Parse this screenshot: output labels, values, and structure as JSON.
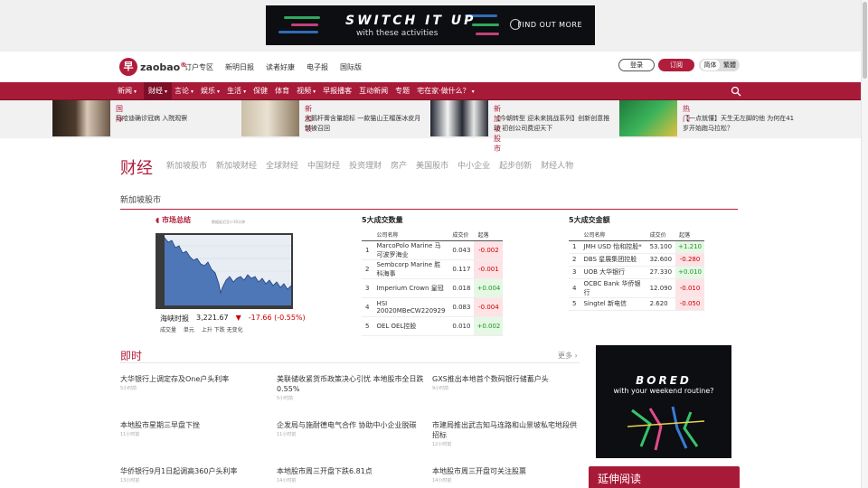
{
  "ad_top": {
    "headline": "SWITCH IT UP",
    "sub": "with these activities",
    "cta": "FIND OUT MORE"
  },
  "masthead": {
    "logo": "zaobao",
    "logo_mark": "早",
    "links": [
      "订户专区",
      "新明日报",
      "读者好康",
      "电子报",
      "国际版"
    ],
    "login": "登录",
    "subscribe": "订阅",
    "lang_simplified": "简体",
    "lang_traditional": "繁體"
  },
  "nav": {
    "items": [
      {
        "label": "新闻",
        "caret": true
      },
      {
        "label": "财经",
        "caret": true
      },
      {
        "label": "言论",
        "caret": true
      },
      {
        "label": "娱乐",
        "caret": true
      },
      {
        "label": "生活",
        "caret": true
      },
      {
        "label": "保健",
        "caret": false
      },
      {
        "label": "体育",
        "caret": false
      },
      {
        "label": "视频",
        "caret": true
      },
      {
        "label": "早报播客",
        "caret": false
      },
      {
        "label": "互动新闻",
        "caret": false
      },
      {
        "label": "专题",
        "caret": false
      },
      {
        "label": "宅在家·做什么？",
        "caret": true
      }
    ]
  },
  "ticker": [
    {
      "cat": "国际",
      "title": "马哈迪确诊冠病 入院观察"
    },
    {
      "cat": "新加坡",
      "title": "大鹅杆膏含量超标 一款猫山王榴莲冰皮月饼被召回"
    },
    {
      "cat": "新加坡股市",
      "title": "【今朝转型 迎未来挑战系列】创新创意推动 初创公司费迎天下"
    },
    {
      "cat": "热门",
      "title": "【一点就懂】天生无左脚的他 为何在41岁开始跑马拉松？"
    }
  ],
  "section": {
    "title": "财经",
    "subnav": [
      "新加坡股市",
      "新加坡财经",
      "全球财经",
      "中国财经",
      "投资理财",
      "房产",
      "美国股市",
      "中小企业",
      "起步创新",
      "财经人物"
    ],
    "subheading": "新加坡股市"
  },
  "market": {
    "header": "市场总结",
    "sub": "数据延迟至少30分钟",
    "index_name": "海峡时报",
    "index_value": "3,221.67",
    "index_change": "-17.66 (-0.55%)",
    "footer": "成交量　 单元　 上升  下跌  无变化"
  },
  "volume_table": {
    "title": "5大成交数量",
    "headers": [
      "公司名称",
      "成交价",
      "起落"
    ],
    "rows": [
      {
        "n": "1",
        "name": "MarcoPolo Marine 马可波罗海业",
        "price": "0.043",
        "chg": "-0.002",
        "dir": "neg"
      },
      {
        "n": "2",
        "name": "Sembcorp Marine 胜科海事",
        "price": "0.117",
        "chg": "-0.001",
        "dir": "neg"
      },
      {
        "n": "3",
        "name": "Imperium Crown 皇冠",
        "price": "0.018",
        "chg": "+0.004",
        "dir": "pos"
      },
      {
        "n": "4",
        "name": "HSI 20020MBeCW220929",
        "price": "0.083",
        "chg": "-0.004",
        "dir": "neg"
      },
      {
        "n": "5",
        "name": "OEL OEL控股",
        "price": "0.010",
        "chg": "+0.002",
        "dir": "pos"
      }
    ]
  },
  "value_table": {
    "title": "5大成交金额",
    "headers": [
      "公司名称",
      "成交价",
      "起落"
    ],
    "rows": [
      {
        "n": "1",
        "name": "JMH USD 怡和控股*",
        "price": "53.100",
        "chg": "+1.210",
        "dir": "pos"
      },
      {
        "n": "2",
        "name": "DBS 星展集团控股",
        "price": "32.600",
        "chg": "-0.280",
        "dir": "neg"
      },
      {
        "n": "3",
        "name": "UOB 大华银行",
        "price": "27.330",
        "chg": "+0.010",
        "dir": "pos"
      },
      {
        "n": "4",
        "name": "OCBC Bank 华侨银行",
        "price": "12.090",
        "chg": "-0.010",
        "dir": "neg"
      },
      {
        "n": "5",
        "name": "Singtel 新电信",
        "price": "2.620",
        "chg": "-0.050",
        "dir": "neg"
      }
    ]
  },
  "instant": {
    "title": "即时",
    "more": "更多",
    "news": [
      {
        "h": "大华银行上调定存及One户头利率",
        "t": "5小时前"
      },
      {
        "h": "美联储收紧货币政策决心引忧 本地股市全日跌0.55%",
        "t": "5小时前"
      },
      {
        "h": "GXS推出本地首个数码银行储蓄户头",
        "t": "9小时前"
      },
      {
        "h": "本地股市星期三早盘下挫",
        "t": "11小时前"
      },
      {
        "h": "企发局与施耐德电气合作 协助中小企业脱碳",
        "t": "11小时前"
      },
      {
        "h": "市建局推出武吉知马连路和山景坡私宅地段供招标",
        "t": "12小时前"
      },
      {
        "h": "华侨银行9月1日起调高360户头利率",
        "t": "13小时前"
      },
      {
        "h": "本地股市周三开盘下跌6.81点",
        "t": "14小时前"
      },
      {
        "h": "本地股市周三开盘可关注股票",
        "t": "14小时前"
      }
    ]
  },
  "ad_side": {
    "headline": "BORED",
    "sub": "with your weekend routine?"
  },
  "extended": "延伸阅读",
  "colors": {
    "brand": "#a81b38",
    "up": "#1a9a1a",
    "down": "#cc0000"
  }
}
